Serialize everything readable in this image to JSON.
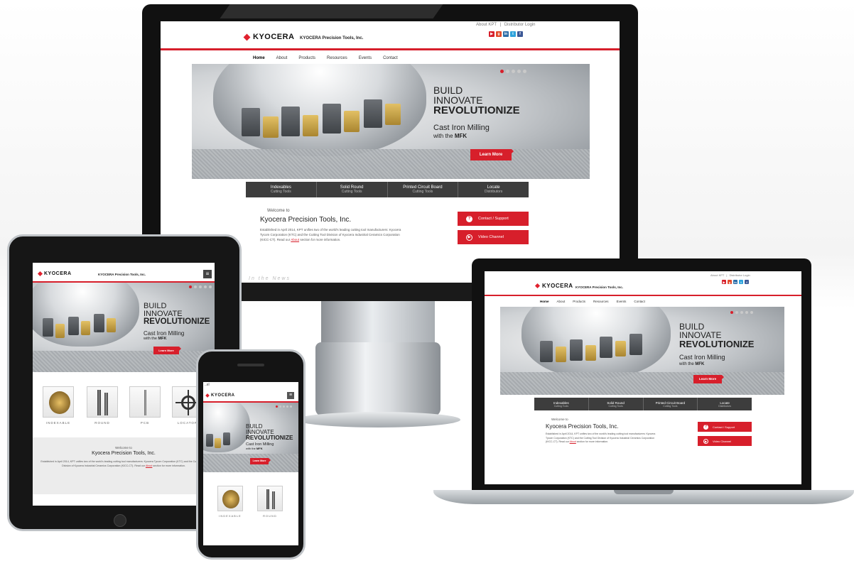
{
  "brand": {
    "logo": "KYOCERA",
    "company": "KYOCERA Precision Tools, Inc.",
    "red": "#d71f2b",
    "dark": "#3d3d3d"
  },
  "top_links": {
    "about": "About KPT",
    "distributor": "Distributor Login"
  },
  "social": [
    {
      "icon": "youtube-icon",
      "glyph": "▶",
      "color": "#d71f2b"
    },
    {
      "icon": "google-plus-icon",
      "glyph": "g",
      "color": "#e24a2a"
    },
    {
      "icon": "linkedin-icon",
      "glyph": "in",
      "color": "#2d6ea8"
    },
    {
      "icon": "twitter-icon",
      "glyph": "t",
      "color": "#2fa3dc"
    },
    {
      "icon": "facebook-icon",
      "glyph": "f",
      "color": "#3b5896"
    }
  ],
  "nav": [
    "Home",
    "About",
    "Products",
    "Resources",
    "Events",
    "Contact"
  ],
  "hero": {
    "line1": "BUILD",
    "line2": "INNOVATE",
    "line3": "REVOLUTIONIZE",
    "sub1": "Cast Iron Milling",
    "sub2_pre": "with the",
    "sub2_bold": "MFK",
    "cta": "Learn More"
  },
  "categories": [
    {
      "title": "Indexables",
      "sub": "Cutting Tools"
    },
    {
      "title": "Solid Round",
      "sub": "Cutting Tools"
    },
    {
      "title": "Printed Circuit Board",
      "sub": "Cutting Tools"
    },
    {
      "title": "Locate",
      "sub": "Distributors"
    }
  ],
  "welcome": {
    "pre": "Welcome to",
    "title": "Kyocera Precision Tools, Inc.",
    "body": "Established in April 2014, KPT unifies two of the world's leading cutting tool manufacturers: Kyocera Tycom Corporation (KTC) and the Cutting Tool Division of Kyocera Industrial Ceramics Corporation (KICC-CT). Read our",
    "link": "About",
    "tail": "section for more information."
  },
  "buttons": {
    "support": "Contact / Support",
    "video": "Video Channel"
  },
  "news": "In the News",
  "products": [
    "INDEXABLE",
    "ROUND",
    "PCB",
    "LOCATOR"
  ],
  "phone_status": "..ııl"
}
